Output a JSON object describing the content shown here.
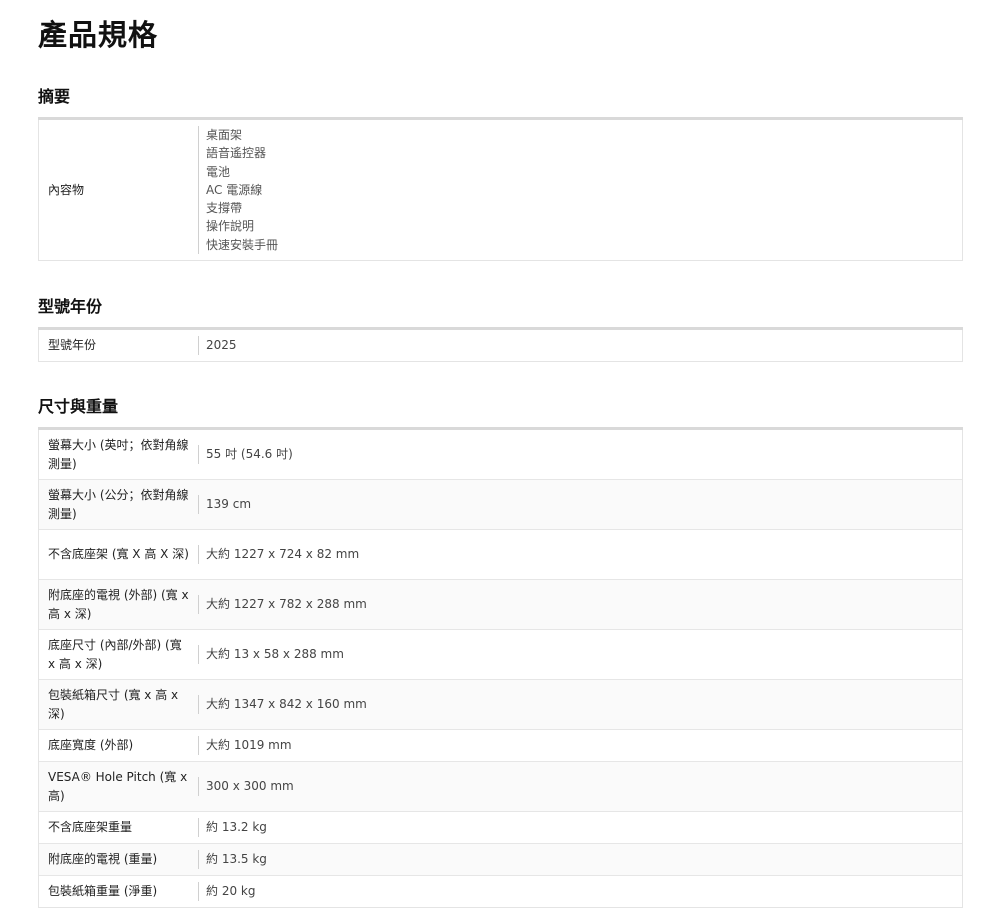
{
  "page_title": "產品規格",
  "sections": {
    "summary": {
      "title": "摘要",
      "rows": [
        {
          "label": "內容物",
          "values": [
            "桌面架",
            "語音遙控器",
            "電池",
            "AC 電源線",
            "支撐帶",
            "操作說明",
            "快速安裝手冊"
          ]
        }
      ]
    },
    "model_year": {
      "title": "型號年份",
      "rows": [
        {
          "label": "型號年份",
          "value": "2025"
        }
      ]
    },
    "dimensions": {
      "title": "尺寸與重量",
      "rows": [
        {
          "label": "螢幕大小 (英吋；依對角線測量)",
          "value": "55 吋 (54.6 吋)"
        },
        {
          "label": "螢幕大小 (公分；依對角線測量)",
          "value": "139 cm"
        },
        {
          "label": "不含底座架 (寬 X 高 X 深)",
          "value": "大約 1227 x 724 x 82 mm"
        },
        {
          "label": "附底座的電視 (外部) (寬 x 高 x 深)",
          "value": "大約 1227 x 782 x 288 mm"
        },
        {
          "label": "底座尺寸 (內部/外部) (寬 x 高 x 深)",
          "value": "大約 13 x 58 x 288 mm"
        },
        {
          "label": "包裝紙箱尺寸 (寬 x 高 x 深)",
          "value": "大約 1347 x 842 x 160 mm"
        },
        {
          "label": "底座寬度 (外部)",
          "value": "大約 1019 mm"
        },
        {
          "label": "VESA® Hole Pitch (寬 x 高)",
          "value": "300 x 300 mm"
        },
        {
          "label": "不含底座架重量",
          "value": "約 13.2 kg"
        },
        {
          "label": "附底座的電視 (重量)",
          "value": "約 13.5 kg"
        },
        {
          "label": "包裝紙箱重量 (淨重)",
          "value": "約 20 kg"
        }
      ]
    }
  }
}
